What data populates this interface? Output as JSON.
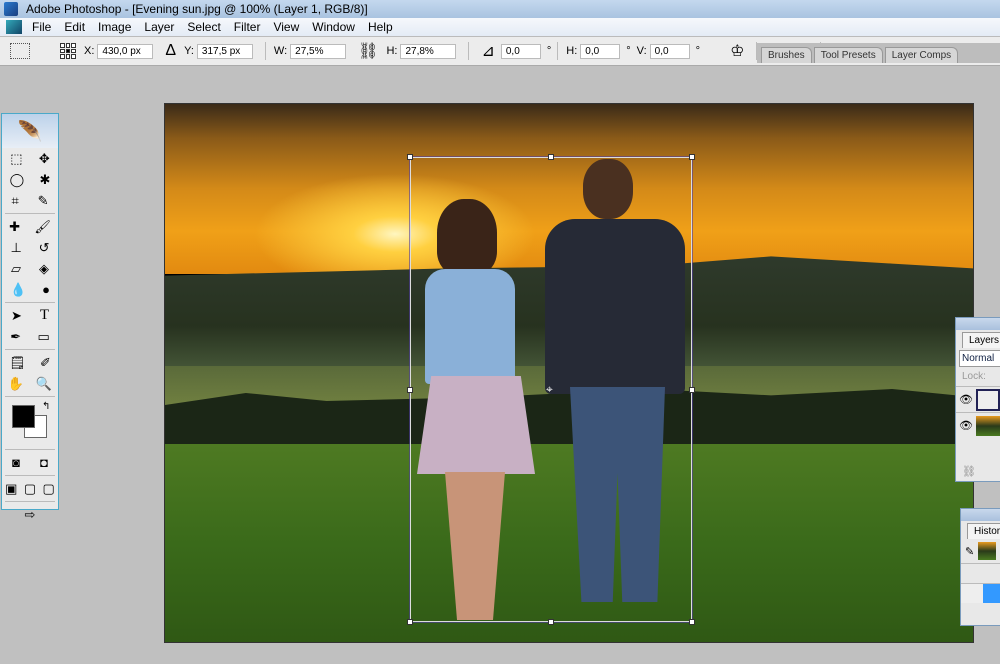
{
  "window": {
    "title": "Adobe Photoshop - [Evening sun.jpg @ 100% (Layer 1, RGB/8)]"
  },
  "menu": [
    "File",
    "Edit",
    "Image",
    "Layer",
    "Select",
    "Filter",
    "View",
    "Window",
    "Help"
  ],
  "options": {
    "x_label": "X:",
    "x": "430,0 px",
    "y_label": "Y:",
    "y": "317,5 px",
    "w_label": "W:",
    "w": "27,5%",
    "h_label": "H:",
    "h": "27,8%",
    "angle": "0,0",
    "hskew_label": "H:",
    "hskew": "0,0",
    "vskew_label": "V:",
    "vskew": "0,0",
    "degree": "°"
  },
  "palette_tabs": [
    "Brushes",
    "Tool Presets",
    "Layer Comps"
  ],
  "layers_panel": {
    "tab": "Layers",
    "blend_mode": "Normal",
    "lock_label": "Lock:"
  },
  "history_panel": {
    "tab": "History"
  },
  "colors": {
    "foreground": "#000000",
    "background": "#ffffff",
    "accent": "#3399ff"
  }
}
